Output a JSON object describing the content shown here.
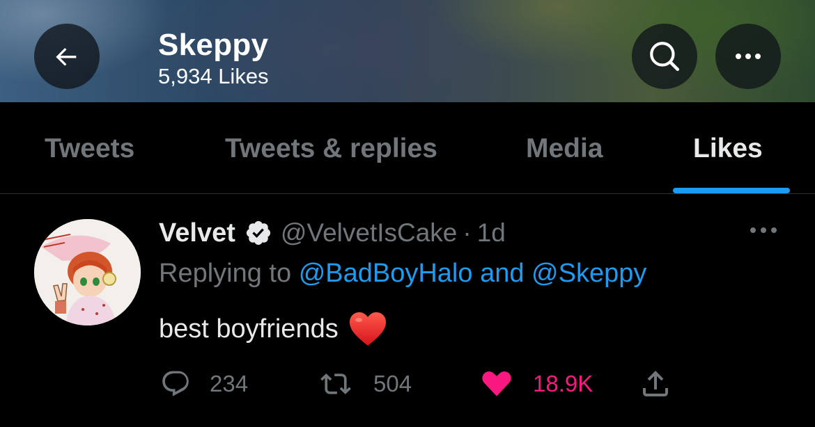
{
  "header": {
    "title": "Skeppy",
    "subtitle": "5,934 Likes",
    "back_icon": "arrow-left-icon",
    "search_icon": "search-icon",
    "more_icon": "more-horizontal-icon"
  },
  "tabs": [
    {
      "label": "Tweets",
      "active": false
    },
    {
      "label": "Tweets & replies",
      "active": false
    },
    {
      "label": "Media",
      "active": false
    },
    {
      "label": "Likes",
      "active": true
    }
  ],
  "tweet": {
    "author": {
      "name": "Velvet",
      "verified": true,
      "handle": "@VelvetIsCake",
      "avatar_icon": "avatar-image"
    },
    "separator": "·",
    "time": "1d",
    "reply": {
      "prefix": "Replying to",
      "mention_1": "@BadBoyHalo",
      "conjunction": "and",
      "mention_2": "@Skeppy"
    },
    "text": "best boyfriends",
    "emoji": "red-heart-emoji",
    "stats": {
      "replies": "234",
      "retweets": "504",
      "likes": "18.9K",
      "liked": true
    }
  },
  "colors": {
    "background": "#000000",
    "accent": "#1d9bf0",
    "like": "#f91880",
    "muted": "#71767b",
    "text": "#e7e9ea"
  }
}
